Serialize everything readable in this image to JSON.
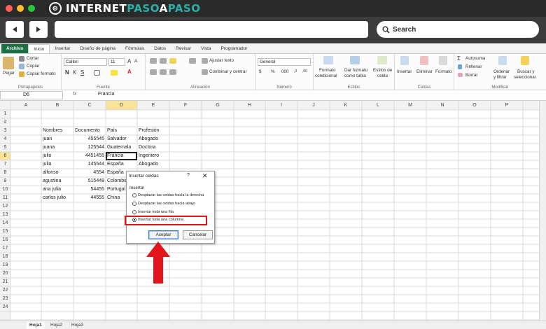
{
  "site": {
    "brand_1": "INTERNET",
    "brand_2": "PASO",
    "brand_3": "A",
    "brand_4": "PASO",
    "search_label": "Search"
  },
  "ribbon": {
    "tabs": [
      "Archivo",
      "Inicio",
      "Insertar",
      "Diseño de página",
      "Fórmulas",
      "Datos",
      "Revisar",
      "Vista",
      "Programador"
    ],
    "paste": "Pegar",
    "cut": "Cortar",
    "copy": "Copiar",
    "copy_format": "Copiar formato",
    "font_name": "Calibri",
    "font_size": "11",
    "wrap_text": "Ajustar texto",
    "merge": "Combinar y centrar",
    "number_format": "General",
    "cond_format_1": "Formato",
    "cond_format_2": "condicional",
    "table_format_1": "Dar formato",
    "table_format_2": "como tabla",
    "cell_styles_1": "Estilos de",
    "cell_styles_2": "celda",
    "insert": "Insertar",
    "delete": "Eliminar",
    "format": "Formato",
    "autosum": "Autosuma",
    "fill": "Rellenar",
    "clear": "Borrar",
    "sort_1": "Ordenar",
    "sort_2": "y filtrar",
    "find_1": "Buscar y",
    "find_2": "seleccionar",
    "groups": {
      "clipboard": "Portapapeles",
      "font": "Fuente",
      "alignment": "Alineación",
      "number": "Número",
      "styles": "Estilos",
      "cells": "Celdas",
      "modify": "Modificar"
    }
  },
  "formula_bar": {
    "cell_ref": "D6",
    "fx": "fx",
    "content": "Francia"
  },
  "grid": {
    "columns": [
      "A",
      "B",
      "C",
      "D",
      "E",
      "F",
      "G",
      "H",
      "I",
      "J",
      "K",
      "L",
      "M",
      "N",
      "O",
      "P"
    ],
    "rows": [
      "1",
      "2",
      "3",
      "4",
      "5",
      "6",
      "7",
      "8",
      "9",
      "10",
      "11",
      "12",
      "13",
      "14",
      "15",
      "16",
      "17",
      "18",
      "19",
      "20",
      "21",
      "22",
      "23",
      "24"
    ],
    "header_row": [
      "Nombres",
      "Documento",
      "País",
      "Profesión"
    ],
    "data": [
      [
        "juan",
        "455545",
        "Salvador",
        "Abogado"
      ],
      [
        "juana",
        "125544",
        "Guatemala",
        "Doctora"
      ],
      [
        "julio",
        "4451455",
        "Francia",
        "Ingeniero"
      ],
      [
        "julia",
        "145544",
        "España",
        "Abogado"
      ],
      [
        "alfonso",
        "4554",
        "España",
        ""
      ],
      [
        "agustina",
        "515448",
        "Colombia",
        ""
      ],
      [
        "ana julia",
        "54455",
        "Portugal",
        ""
      ],
      [
        "carlos julio",
        "44555",
        "China",
        ""
      ]
    ]
  },
  "dialog": {
    "title": "Insertar celdas",
    "help": "?",
    "close": "✕",
    "section": "Insertar",
    "options": [
      "Desplazar las celdas hacia la derecha",
      "Desplazar las celdas hacia abajo",
      "Insertar toda una fila",
      "Insertar toda una columna"
    ],
    "selected_index": 3,
    "ok": "Aceptar",
    "cancel": "Cancelar"
  },
  "sheets": [
    "Hoja1",
    "Hoja2",
    "Hoja3"
  ],
  "colors": {
    "excel_green": "#1e7145",
    "highlight_red": "#e01414",
    "arrow_red": "#e3141b"
  }
}
